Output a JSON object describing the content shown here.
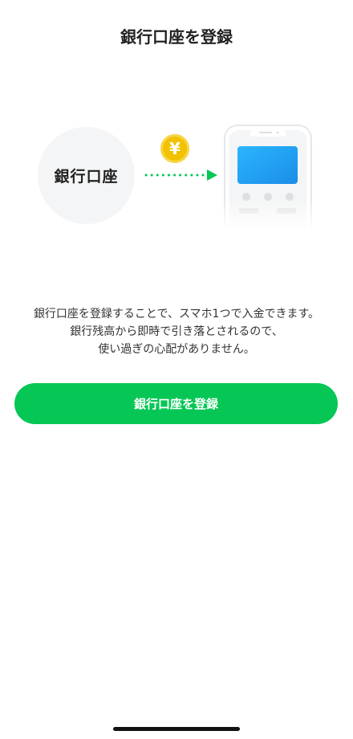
{
  "header": {
    "title": "銀行口座を登録"
  },
  "illustration": {
    "bank_label": "銀行口座",
    "coin_symbol": "¥",
    "icons": [
      "bank-circle",
      "yen-coin-icon",
      "dotted-arrow-icon",
      "smartphone-icon"
    ],
    "colors": {
      "coin": "#F2C200",
      "arrow": "#06C755",
      "phone_screen": "#1EA6FF"
    }
  },
  "description": {
    "lines": [
      "銀行口座を登録することで、スマホ1つで入金できます。",
      "銀行残高から即時で引き落とされるので、",
      "使い過ぎの心配がありません。"
    ]
  },
  "actions": {
    "register_label": "銀行口座を登録"
  },
  "theme": {
    "accent": "#06C755",
    "text": "#222222"
  }
}
